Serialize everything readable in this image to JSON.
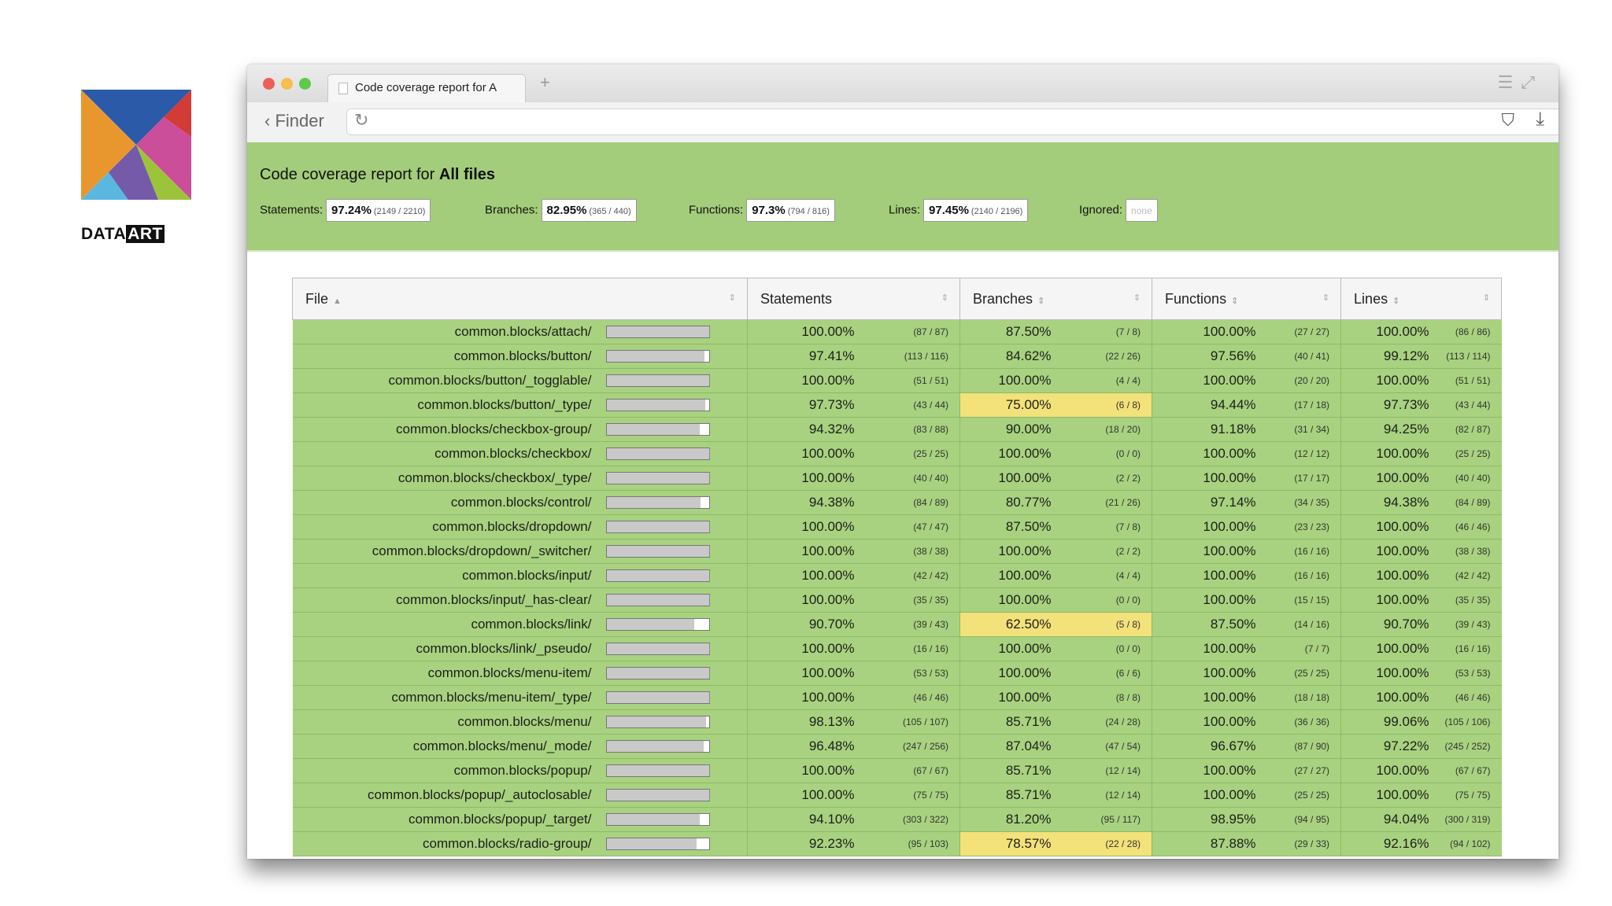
{
  "logo": {
    "text_left": "DATA",
    "text_right": "ART"
  },
  "browser": {
    "tab_title": "Code coverage report for A",
    "back_label": "Finder",
    "colors": {
      "close": "#ec5f57",
      "minimize": "#f5be4f",
      "maximize": "#5fc94e"
    }
  },
  "report": {
    "title_prefix": "Code coverage report for",
    "title_target": "All files",
    "summary": {
      "statements": {
        "label": "Statements:",
        "pct": "97.24%",
        "fraction": "(2149 / 2210)"
      },
      "branches": {
        "label": "Branches:",
        "pct": "82.95%",
        "fraction": "(365 / 440)"
      },
      "functions": {
        "label": "Functions:",
        "pct": "97.3%",
        "fraction": "(794 / 816)"
      },
      "lines": {
        "label": "Lines:",
        "pct": "97.45%",
        "fraction": "(2140 / 2196)"
      },
      "ignored": {
        "label": "Ignored:",
        "value": "none"
      }
    },
    "columns": {
      "file": "File",
      "statements": "Statements",
      "branches": "Branches",
      "functions": "Functions",
      "lines": "Lines"
    },
    "rows": [
      {
        "file": "common.blocks/attach/",
        "cov": 1.0,
        "s": "100.00%",
        "sf": "(87 / 87)",
        "b": "87.50%",
        "bf": "(7 / 8)",
        "f": "100.00%",
        "ff": "(27 / 27)",
        "l": "100.00%",
        "lf": "(86 / 86)",
        "low": false
      },
      {
        "file": "common.blocks/button/",
        "cov": 0.9741,
        "s": "97.41%",
        "sf": "(113 / 116)",
        "b": "84.62%",
        "bf": "(22 / 26)",
        "f": "97.56%",
        "ff": "(40 / 41)",
        "l": "99.12%",
        "lf": "(113 / 114)",
        "low": false
      },
      {
        "file": "common.blocks/button/_togglable/",
        "cov": 1.0,
        "s": "100.00%",
        "sf": "(51 / 51)",
        "b": "100.00%",
        "bf": "(4 / 4)",
        "f": "100.00%",
        "ff": "(20 / 20)",
        "l": "100.00%",
        "lf": "(51 / 51)",
        "low": false
      },
      {
        "file": "common.blocks/button/_type/",
        "cov": 0.9773,
        "s": "97.73%",
        "sf": "(43 / 44)",
        "b": "75.00%",
        "bf": "(6 / 8)",
        "f": "94.44%",
        "ff": "(17 / 18)",
        "l": "97.73%",
        "lf": "(43 / 44)",
        "low": true
      },
      {
        "file": "common.blocks/checkbox-group/",
        "cov": 0.9432,
        "s": "94.32%",
        "sf": "(83 / 88)",
        "b": "90.00%",
        "bf": "(18 / 20)",
        "f": "91.18%",
        "ff": "(31 / 34)",
        "l": "94.25%",
        "lf": "(82 / 87)",
        "low": false
      },
      {
        "file": "common.blocks/checkbox/",
        "cov": 1.0,
        "s": "100.00%",
        "sf": "(25 / 25)",
        "b": "100.00%",
        "bf": "(0 / 0)",
        "f": "100.00%",
        "ff": "(12 / 12)",
        "l": "100.00%",
        "lf": "(25 / 25)",
        "low": false
      },
      {
        "file": "common.blocks/checkbox/_type/",
        "cov": 1.0,
        "s": "100.00%",
        "sf": "(40 / 40)",
        "b": "100.00%",
        "bf": "(2 / 2)",
        "f": "100.00%",
        "ff": "(17 / 17)",
        "l": "100.00%",
        "lf": "(40 / 40)",
        "low": false
      },
      {
        "file": "common.blocks/control/",
        "cov": 0.9438,
        "s": "94.38%",
        "sf": "(84 / 89)",
        "b": "80.77%",
        "bf": "(21 / 26)",
        "f": "97.14%",
        "ff": "(34 / 35)",
        "l": "94.38%",
        "lf": "(84 / 89)",
        "low": false
      },
      {
        "file": "common.blocks/dropdown/",
        "cov": 1.0,
        "s": "100.00%",
        "sf": "(47 / 47)",
        "b": "87.50%",
        "bf": "(7 / 8)",
        "f": "100.00%",
        "ff": "(23 / 23)",
        "l": "100.00%",
        "lf": "(46 / 46)",
        "low": false
      },
      {
        "file": "common.blocks/dropdown/_switcher/",
        "cov": 1.0,
        "s": "100.00%",
        "sf": "(38 / 38)",
        "b": "100.00%",
        "bf": "(2 / 2)",
        "f": "100.00%",
        "ff": "(16 / 16)",
        "l": "100.00%",
        "lf": "(38 / 38)",
        "low": false
      },
      {
        "file": "common.blocks/input/",
        "cov": 1.0,
        "s": "100.00%",
        "sf": "(42 / 42)",
        "b": "100.00%",
        "bf": "(4 / 4)",
        "f": "100.00%",
        "ff": "(16 / 16)",
        "l": "100.00%",
        "lf": "(42 / 42)",
        "low": false
      },
      {
        "file": "common.blocks/input/_has-clear/",
        "cov": 1.0,
        "s": "100.00%",
        "sf": "(35 / 35)",
        "b": "100.00%",
        "bf": "(0 / 0)",
        "f": "100.00%",
        "ff": "(15 / 15)",
        "l": "100.00%",
        "lf": "(35 / 35)",
        "low": false
      },
      {
        "file": "common.blocks/link/",
        "cov": 0.907,
        "s": "90.70%",
        "sf": "(39 / 43)",
        "b": "62.50%",
        "bf": "(5 / 8)",
        "f": "87.50%",
        "ff": "(14 / 16)",
        "l": "90.70%",
        "lf": "(39 / 43)",
        "low": true
      },
      {
        "file": "common.blocks/link/_pseudo/",
        "cov": 1.0,
        "s": "100.00%",
        "sf": "(16 / 16)",
        "b": "100.00%",
        "bf": "(0 / 0)",
        "f": "100.00%",
        "ff": "(7 / 7)",
        "l": "100.00%",
        "lf": "(16 / 16)",
        "low": false
      },
      {
        "file": "common.blocks/menu-item/",
        "cov": 1.0,
        "s": "100.00%",
        "sf": "(53 / 53)",
        "b": "100.00%",
        "bf": "(6 / 6)",
        "f": "100.00%",
        "ff": "(25 / 25)",
        "l": "100.00%",
        "lf": "(53 / 53)",
        "low": false
      },
      {
        "file": "common.blocks/menu-item/_type/",
        "cov": 1.0,
        "s": "100.00%",
        "sf": "(46 / 46)",
        "b": "100.00%",
        "bf": "(8 / 8)",
        "f": "100.00%",
        "ff": "(18 / 18)",
        "l": "100.00%",
        "lf": "(46 / 46)",
        "low": false
      },
      {
        "file": "common.blocks/menu/",
        "cov": 0.9813,
        "s": "98.13%",
        "sf": "(105 / 107)",
        "b": "85.71%",
        "bf": "(24 / 28)",
        "f": "100.00%",
        "ff": "(36 / 36)",
        "l": "99.06%",
        "lf": "(105 / 106)",
        "low": false
      },
      {
        "file": "common.blocks/menu/_mode/",
        "cov": 0.9648,
        "s": "96.48%",
        "sf": "(247 / 256)",
        "b": "87.04%",
        "bf": "(47 / 54)",
        "f": "96.67%",
        "ff": "(87 / 90)",
        "l": "97.22%",
        "lf": "(245 / 252)",
        "low": false
      },
      {
        "file": "common.blocks/popup/",
        "cov": 1.0,
        "s": "100.00%",
        "sf": "(67 / 67)",
        "b": "85.71%",
        "bf": "(12 / 14)",
        "f": "100.00%",
        "ff": "(27 / 27)",
        "l": "100.00%",
        "lf": "(67 / 67)",
        "low": false
      },
      {
        "file": "common.blocks/popup/_autoclosable/",
        "cov": 1.0,
        "s": "100.00%",
        "sf": "(75 / 75)",
        "b": "85.71%",
        "bf": "(12 / 14)",
        "f": "100.00%",
        "ff": "(25 / 25)",
        "l": "100.00%",
        "lf": "(75 / 75)",
        "low": false
      },
      {
        "file": "common.blocks/popup/_target/",
        "cov": 0.941,
        "s": "94.10%",
        "sf": "(303 / 322)",
        "b": "81.20%",
        "bf": "(95 / 117)",
        "f": "98.95%",
        "ff": "(94 / 95)",
        "l": "94.04%",
        "lf": "(300 / 319)",
        "low": false
      },
      {
        "file": "common.blocks/radio-group/",
        "cov": 0.9223,
        "s": "92.23%",
        "sf": "(95 / 103)",
        "b": "78.57%",
        "bf": "(22 / 28)",
        "f": "87.88%",
        "ff": "(29 / 33)",
        "l": "92.16%",
        "lf": "(94 / 102)",
        "low": true
      }
    ]
  }
}
